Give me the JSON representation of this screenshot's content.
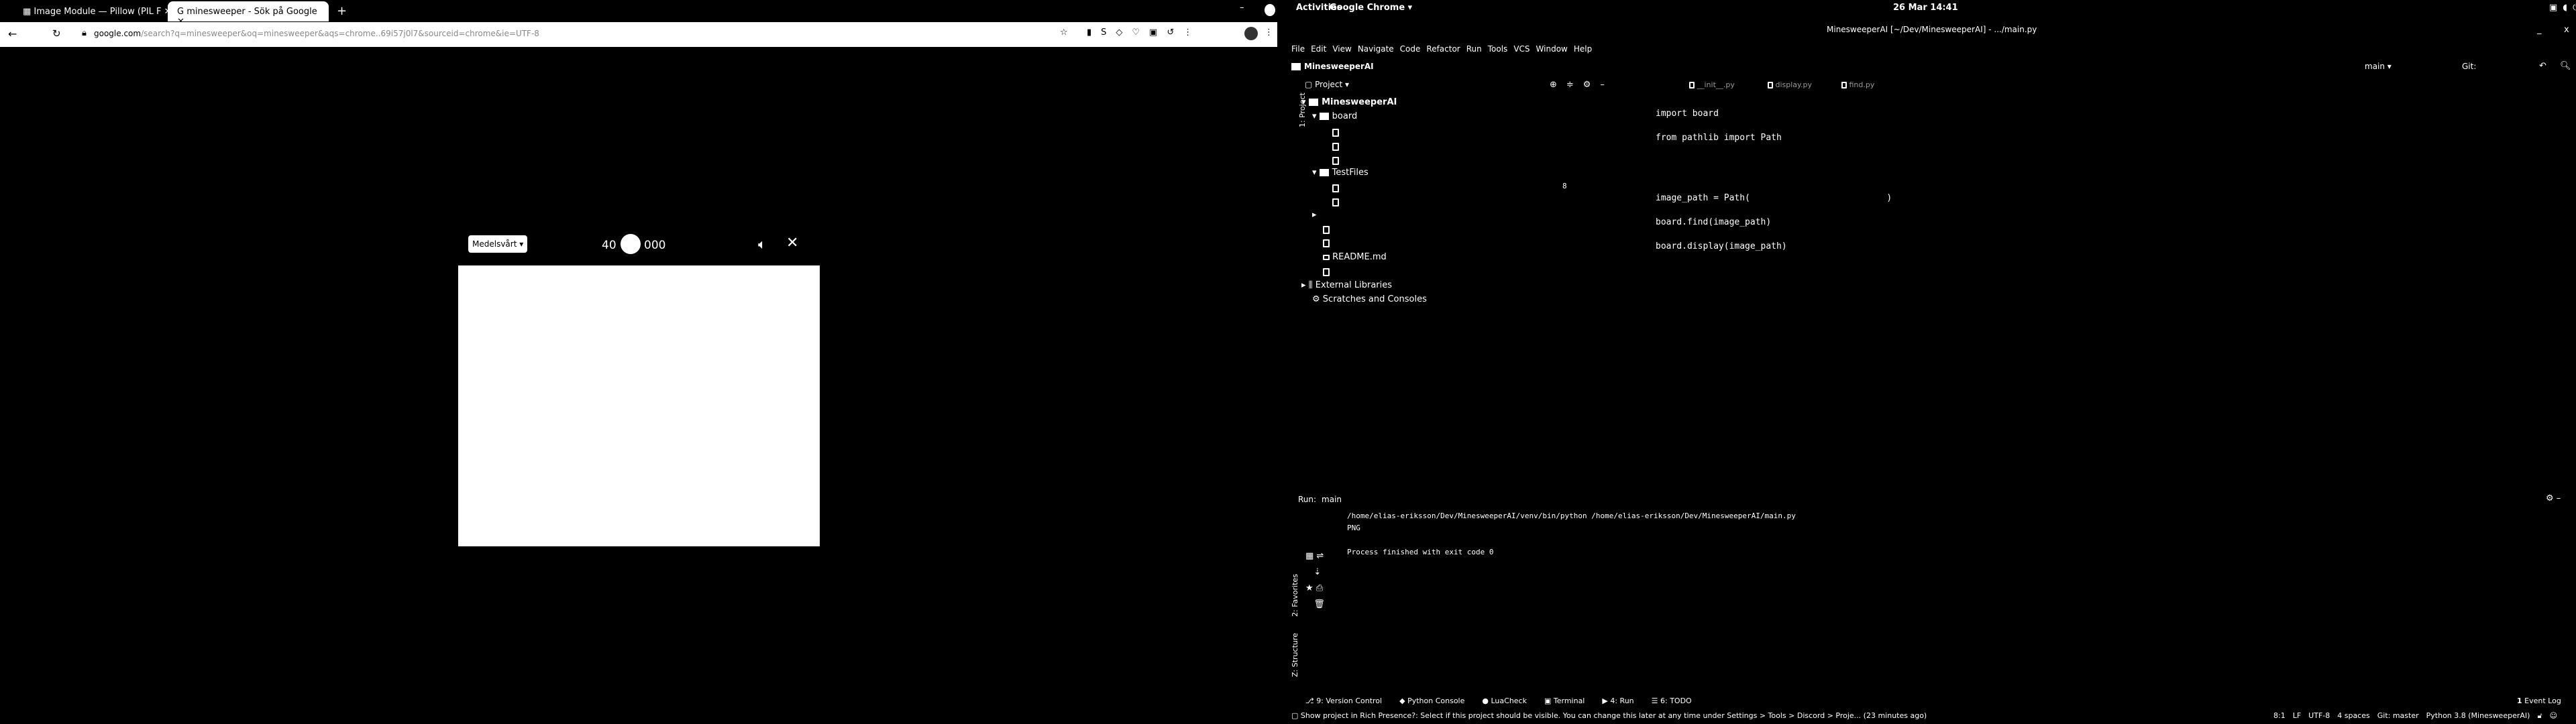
{
  "chrome": {
    "tabs": [
      {
        "label": "Image Module — Pillow (PIL F",
        "icon": "doc-icon"
      },
      {
        "label": "minesweeper - Sök på Google",
        "icon": "google-icon"
      }
    ],
    "url_host": "google.com",
    "url_rest": "/search?q=minesweeper&oq=minesweeper&aqs=chrome..69i57j0l7&sourceid=chrome&ie=UTF-8",
    "game": {
      "difficulty": "Medelsvårt",
      "mines": "40",
      "time": "000"
    }
  },
  "gnome": {
    "activities": "Activities",
    "app": "Google Chrome",
    "clock": "26 Mar  14:41"
  },
  "ide": {
    "title": "MinesweeperAI [~/Dev/MinesweeperAI] - .../main.py",
    "menu": [
      "File",
      "Edit",
      "View",
      "Navigate",
      "Code",
      "Refactor",
      "Run",
      "Tools",
      "VCS",
      "Window",
      "Help"
    ],
    "nav_project": "MinesweeperAI",
    "run_config": "main",
    "git_label": "Git:",
    "project_dropdown": "Project",
    "side_project": "1: Project",
    "side_favorites": "2: Favorites",
    "side_structure": "Z: Structure",
    "editor_tabs": [
      "__init__.py",
      "display.py",
      "find.py"
    ],
    "tree": {
      "root": "MinesweeperAI",
      "board": "board",
      "testfiles": "TestFiles",
      "readme": "README.md",
      "ext": "External Libraries",
      "scratches": "Scratches and Consoles"
    },
    "code": [
      "import board",
      "from pathlib import Path",
      "",
      "image_path = Path(                          )",
      "board.find(image_path)",
      "board.display(image_path)"
    ],
    "gutter_mark": "8",
    "run": {
      "label": "Run:",
      "config": "main",
      "cmd": "/home/elias-eriksson/Dev/MinesweeperAI/venv/bin/python /home/elias-eriksson/Dev/MinesweeperAI/main.py",
      "out": "PNG",
      "exit": "Process finished with exit code 0"
    },
    "bottom_tabs": [
      "9: Version Control",
      "Python Console",
      "LuaCheck",
      "Terminal",
      "4: Run",
      "6: TODO"
    ],
    "event_log": "Event Log",
    "event_count": "1",
    "status_msg": "Show project in Rich Presence?: Select if this project should be visible. You can change this later at any time under Settings > Tools > Discord > Proje... (23 minutes ago)",
    "status_right": [
      "8:1",
      "LF",
      "UTF-8",
      "4 spaces",
      "Git: master",
      "Python 3.8 (MinesweeperAI)"
    ]
  }
}
